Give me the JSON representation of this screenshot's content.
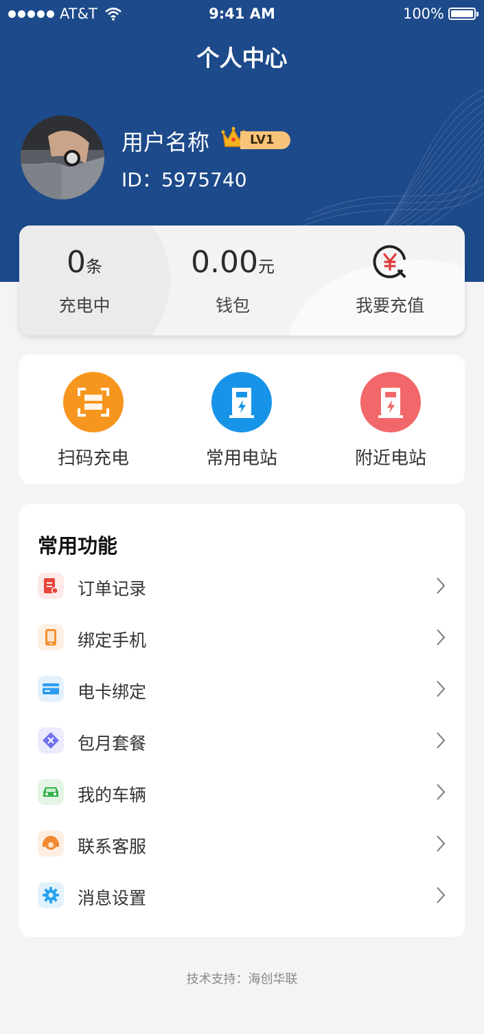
{
  "status_bar": {
    "carrier": "AT&T",
    "time": "9:41 AM",
    "battery": "100%"
  },
  "header": {
    "title": "个人中心"
  },
  "user": {
    "name": "用户名称",
    "level": "LV1",
    "id": "ID：5975740"
  },
  "wallet": {
    "charging_count": "0",
    "charging_unit": "条",
    "charging_label": "充电中",
    "balance": "0.00",
    "balance_unit": "元",
    "balance_label": "钱包",
    "recharge_label": "我要充值"
  },
  "quick_actions": [
    {
      "label": "扫码充电",
      "icon": "scan-icon",
      "color": "#f7961e"
    },
    {
      "label": "常用电站",
      "icon": "charging-station-icon",
      "color": "#1794e8"
    },
    {
      "label": "附近电站",
      "icon": "charging-station-icon",
      "color": "#f2686a"
    }
  ],
  "functions": {
    "title": "常用功能",
    "items": [
      {
        "label": "订单记录",
        "icon": "order-icon",
        "color": "#e8453c"
      },
      {
        "label": "绑定手机",
        "icon": "phone-icon",
        "color": "#f39233"
      },
      {
        "label": "电卡绑定",
        "icon": "card-icon",
        "color": "#2b9cf0"
      },
      {
        "label": "包月套餐",
        "icon": "ticket-icon",
        "color": "#6f74ec"
      },
      {
        "label": "我的车辆",
        "icon": "car-icon",
        "color": "#36b24b"
      },
      {
        "label": "联系客服",
        "icon": "headset-icon",
        "color": "#f08a30"
      },
      {
        "label": "消息设置",
        "icon": "gear-icon",
        "color": "#2aa3ef"
      }
    ]
  },
  "footer": {
    "text": "技术支持：海创华联"
  }
}
